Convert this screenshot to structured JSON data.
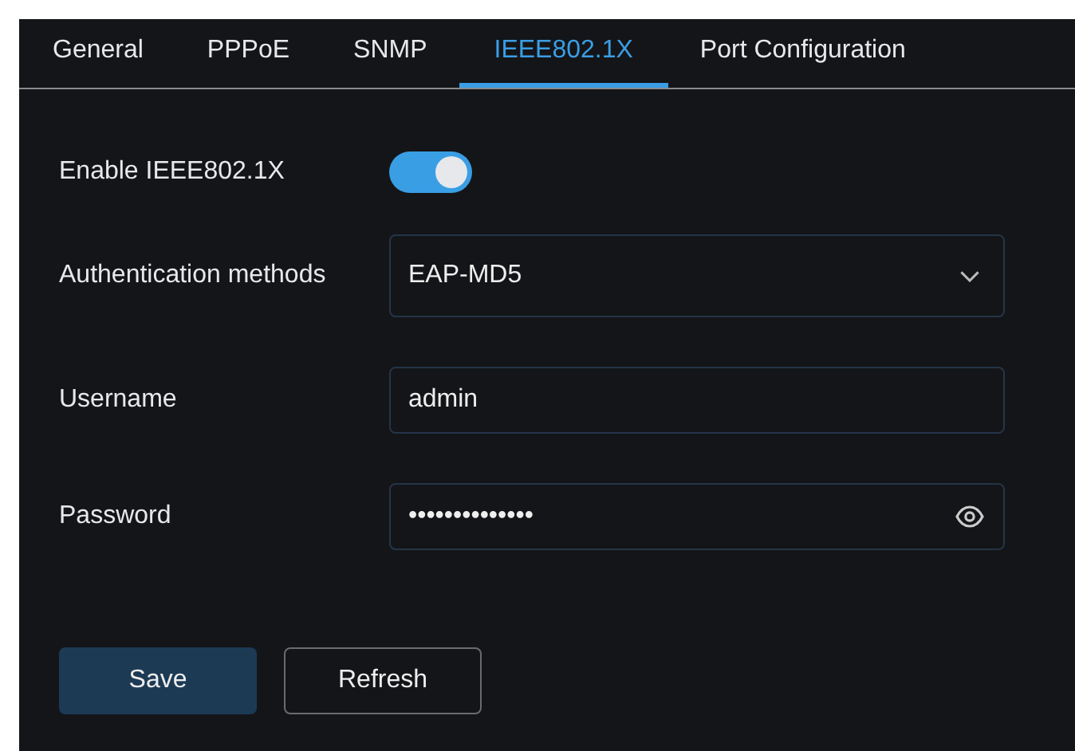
{
  "tabs": [
    {
      "label": "General",
      "selected": false
    },
    {
      "label": "PPPoE",
      "selected": false
    },
    {
      "label": "SNMP",
      "selected": false
    },
    {
      "label": "IEEE802.1X",
      "selected": true
    },
    {
      "label": "Port Configuration",
      "selected": false
    }
  ],
  "form": [
    {
      "kind": "toggle",
      "label": "Enable IEEE802.1X",
      "on": true
    },
    {
      "kind": "select",
      "label": "Authentication methods",
      "value": "EAP-MD5"
    },
    {
      "kind": "text",
      "label": "Username",
      "value": "admin"
    },
    {
      "kind": "password",
      "label": "Password",
      "value": "••••••••••••••"
    }
  ],
  "buttons": [
    {
      "label": "Save",
      "kind": "primary"
    },
    {
      "label": "Refresh",
      "kind": "secondary"
    }
  ]
}
